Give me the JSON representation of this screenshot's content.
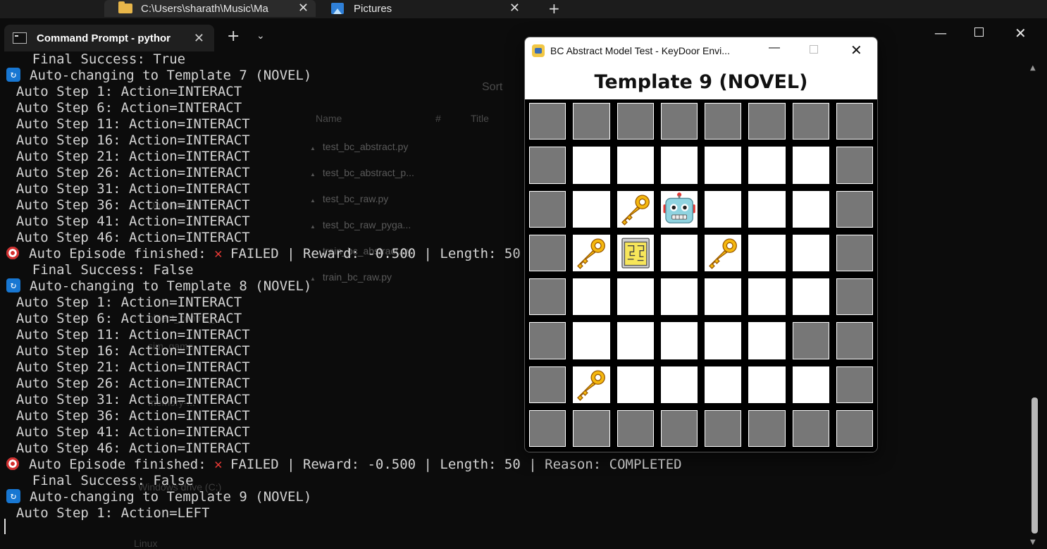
{
  "explorer": {
    "tabs": [
      {
        "label": "C:\\Users\\sharath\\Music\\Ma"
      },
      {
        "label": "Pictures"
      }
    ],
    "toolbar_sort": "Sort",
    "columns": {
      "name": "Name",
      "number": "#",
      "title": "Title"
    },
    "files": [
      "test_bc_abstract.py",
      "test_bc_abstract_p...",
      "test_bc_raw.py",
      "test_bc_raw_pyga...",
      "train_bc_abstract.py",
      "train_bc_raw.py"
    ],
    "sidebar_fragments": [
      "Downloads",
      "object_centric_...",
      "sim_game...",
      "memory-...",
      "Windows drive (C:)",
      "Linux"
    ]
  },
  "terminal": {
    "tab_title": "Command Prompt - pythor",
    "lines": [
      {
        "kind": "text",
        "text": "    Final Success: True"
      },
      {
        "kind": "badge",
        "text": "Auto-changing to Template 7 (NOVEL)"
      },
      {
        "kind": "text",
        "text": "  Auto Step 1: Action=INTERACT"
      },
      {
        "kind": "text",
        "text": "  Auto Step 6: Action=INTERACT"
      },
      {
        "kind": "text",
        "text": "  Auto Step 11: Action=INTERACT"
      },
      {
        "kind": "text",
        "text": "  Auto Step 16: Action=INTERACT"
      },
      {
        "kind": "text",
        "text": "  Auto Step 21: Action=INTERACT"
      },
      {
        "kind": "text",
        "text": "  Auto Step 26: Action=INTERACT"
      },
      {
        "kind": "text",
        "text": "  Auto Step 31: Action=INTERACT"
      },
      {
        "kind": "text",
        "text": "  Auto Step 36: Action=INTERACT"
      },
      {
        "kind": "text",
        "text": "  Auto Step 41: Action=INTERACT"
      },
      {
        "kind": "text",
        "text": "  Auto Step 46: Action=INTERACT"
      },
      {
        "kind": "episode",
        "prefix": "Auto Episode finished: ",
        "status": "FAILED",
        "suffix": " | Reward: -0.500 | Length: 50 | Reason: COMPLETED"
      },
      {
        "kind": "text",
        "text": "    Final Success: False"
      },
      {
        "kind": "badge",
        "text": "Auto-changing to Template 8 (NOVEL)"
      },
      {
        "kind": "text",
        "text": "  Auto Step 1: Action=INTERACT"
      },
      {
        "kind": "text",
        "text": "  Auto Step 6: Action=INTERACT"
      },
      {
        "kind": "text",
        "text": "  Auto Step 11: Action=INTERACT"
      },
      {
        "kind": "text",
        "text": "  Auto Step 16: Action=INTERACT"
      },
      {
        "kind": "text",
        "text": "  Auto Step 21: Action=INTERACT"
      },
      {
        "kind": "text",
        "text": "  Auto Step 26: Action=INTERACT"
      },
      {
        "kind": "text",
        "text": "  Auto Step 31: Action=INTERACT"
      },
      {
        "kind": "text",
        "text": "  Auto Step 36: Action=INTERACT"
      },
      {
        "kind": "text",
        "text": "  Auto Step 41: Action=INTERACT"
      },
      {
        "kind": "text",
        "text": "  Auto Step 46: Action=INTERACT"
      },
      {
        "kind": "episode",
        "prefix": "Auto Episode finished: ",
        "status": "FAILED",
        "suffix": " | Reward: -0.500 | Length: 50 | Reason: COMPLETED"
      },
      {
        "kind": "text",
        "text": "    Final Success: False"
      },
      {
        "kind": "badge",
        "text": "Auto-changing to Template 9 (NOVEL)"
      },
      {
        "kind": "text",
        "text": "  Auto Step 1: Action=LEFT"
      }
    ]
  },
  "pygame": {
    "window_title": "BC Abstract Model Test - KeyDoor Envi...",
    "header": "Template 9 (NOVEL)",
    "grid": [
      [
        "wall",
        "wall",
        "wall",
        "wall",
        "wall",
        "wall",
        "wall",
        "wall"
      ],
      [
        "wall",
        "empty",
        "empty",
        "empty",
        "empty",
        "empty",
        "empty",
        "wall"
      ],
      [
        "wall",
        "empty",
        "key",
        "robot",
        "empty",
        "empty",
        "empty",
        "wall"
      ],
      [
        "wall",
        "key",
        "door",
        "empty",
        "key",
        "empty",
        "empty",
        "wall"
      ],
      [
        "wall",
        "empty",
        "empty",
        "empty",
        "empty",
        "empty",
        "empty",
        "wall"
      ],
      [
        "wall",
        "empty",
        "empty",
        "empty",
        "empty",
        "empty",
        "wall",
        "wall"
      ],
      [
        "wall",
        "key",
        "empty",
        "empty",
        "empty",
        "empty",
        "empty",
        "wall"
      ],
      [
        "wall",
        "wall",
        "wall",
        "wall",
        "wall",
        "wall",
        "wall",
        "wall"
      ]
    ],
    "colors": {
      "wall": "#777777",
      "floor": "#ffffff",
      "key": "#f5b80f",
      "door": "#f7e65a",
      "robot": "#8fd3e0"
    }
  }
}
